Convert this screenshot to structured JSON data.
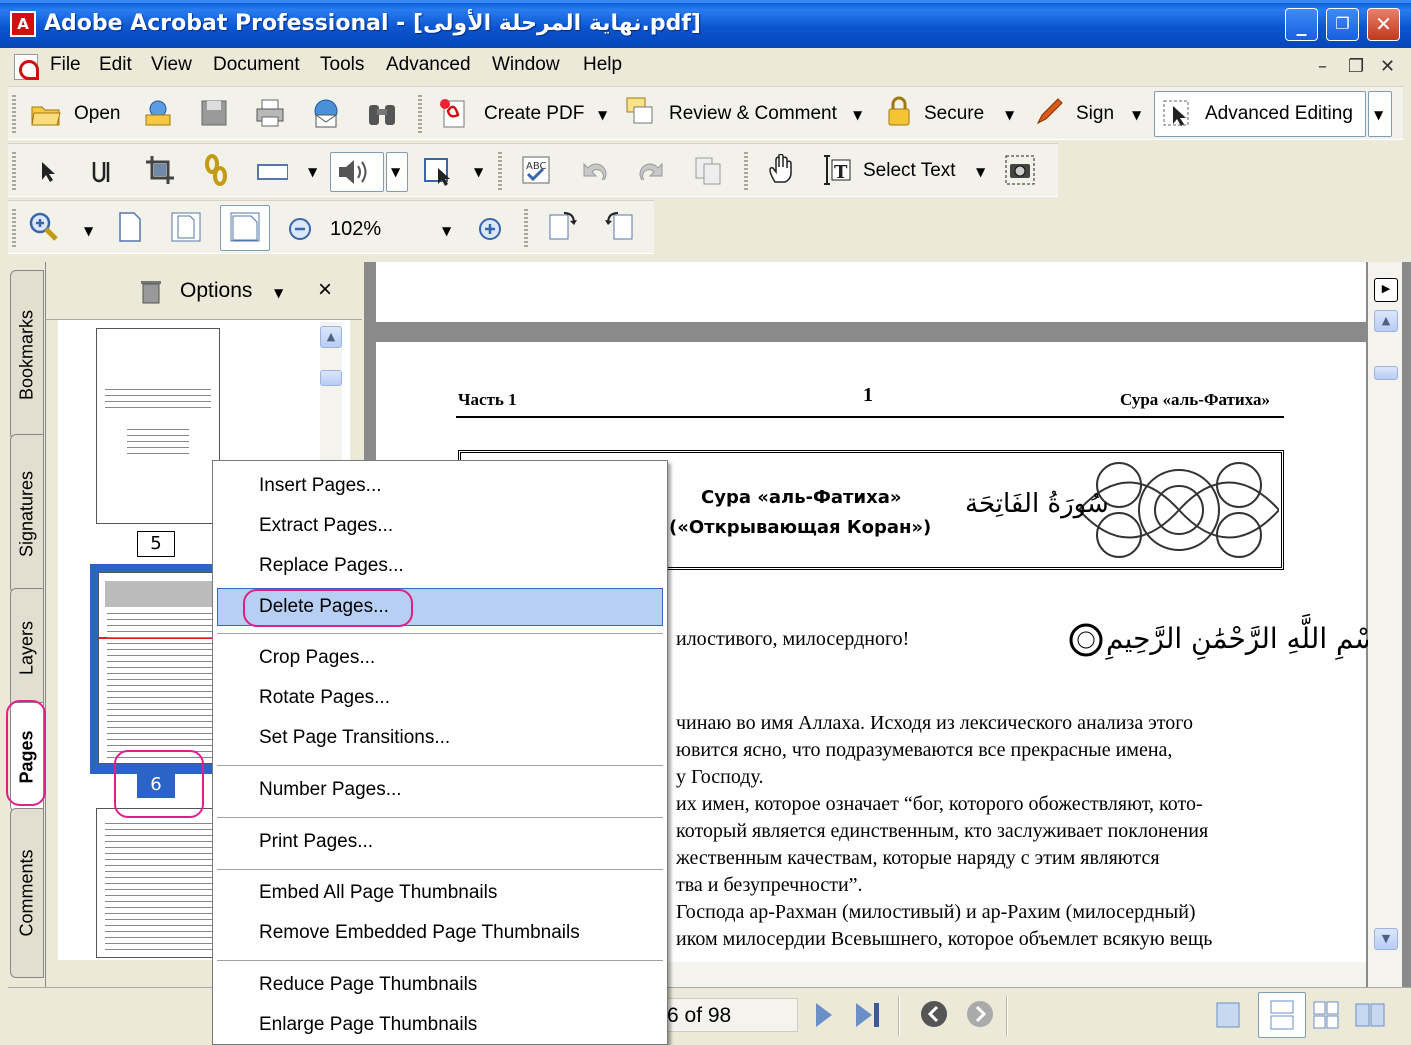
{
  "window": {
    "title": "Adobe Acrobat Professional - [نهاية المرحلة الأولى.pdf]",
    "app_icon": "A",
    "minimize": "_",
    "restore": "❐",
    "close": "✕"
  },
  "menubar": {
    "items": [
      "File",
      "Edit",
      "View",
      "Document",
      "Tools",
      "Advanced",
      "Window",
      "Help"
    ]
  },
  "toolbar1": {
    "open": "Open",
    "create_pdf": "Create PDF",
    "review_comment": "Review & Comment",
    "secure": "Secure",
    "sign": "Sign",
    "advanced_editing": "Advanced Editing"
  },
  "toolbar2": {
    "select_text": "Select Text"
  },
  "toolbar3": {
    "zoom_value": "102%"
  },
  "nav_tabs": [
    "Bookmarks",
    "Signatures",
    "Layers",
    "Pages",
    "Comments"
  ],
  "thumbs_panel": {
    "options": "Options",
    "close": "×",
    "pages": [
      "5",
      "6"
    ]
  },
  "document": {
    "header_left": "Часть 1",
    "header_center": "1",
    "header_right": "Сура «аль-Фатиха»",
    "banner_title_1": "Сура «аль-Фатиха»",
    "banner_title_2": "(«Открывающая Коран»)",
    "banner_arabic": "سُورَةُ الفَاتِحَة",
    "basmala_ru": "илостивого, милосердного!",
    "basmala_ar": "بِسْمِ اللَّهِ الرَّحْمَٰنِ الرَّحِيمِ",
    "para": [
      "чинаю во имя Аллаха. Исходя из лексического анализа этого",
      "ювится ясно, что подразумеваются все прекрасные имена,",
      "у Господу.",
      "их имен, которое означает “бог, которого обожествляют, кото-",
      "который является единственным, кто заслуживает поклонения",
      "жественным качествам, которые наряду с этим являются",
      "тва и безупречности”.",
      "Господа ар-Рахман (милостивый) и ар-Рахим (милосердный)",
      "иком милосердии Всевышнего, которое объемлет всякую вещь"
    ]
  },
  "status": {
    "page_of": "6 of 98"
  },
  "context_menu": {
    "items": [
      "Insert Pages...",
      "Extract Pages...",
      "Replace Pages...",
      "Delete Pages...",
      "Crop Pages...",
      "Rotate Pages...",
      "Set Page Transitions...",
      "Number Pages...",
      "Print Pages...",
      "Embed All Page Thumbnails",
      "Remove Embedded Page Thumbnails",
      "Reduce Page Thumbnails",
      "Enlarge Page Thumbnails"
    ],
    "highlighted": "Delete Pages..."
  },
  "colors": {
    "titlebar": "#0a55d0",
    "highlight": "#b6cff2",
    "annotation_ring": "#e0208a",
    "selected_thumb": "#2b63c6"
  }
}
